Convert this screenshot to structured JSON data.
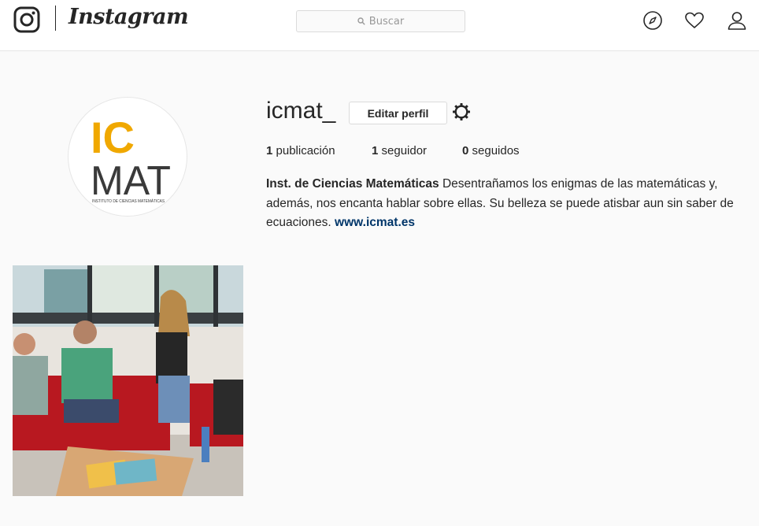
{
  "header": {
    "wordmark": "Instagram",
    "search": {
      "placeholder": "Buscar"
    }
  },
  "profile": {
    "username": "icmat_",
    "edit_label": "Editar perfil",
    "avatar_logo": {
      "line1": "IC",
      "line2": "MAT",
      "tagline": "INSTITUTO DE CIENCIAS MATEMÁTICAS"
    },
    "stats": {
      "posts_count": "1",
      "posts_label": "publicación",
      "followers_count": "1",
      "followers_label": "seguidor",
      "following_count": "0",
      "following_label": "seguidos"
    },
    "bio": {
      "name": "Inst. de Ciencias Matemáticas",
      "text": "Desentrañamos los enigmas de las matemáticas y, además, nos encanta hablar sobre ellas. Su belleza se puede atisbar aun sin saber de ecuaciones.",
      "link": "www.icmat.es"
    }
  },
  "colors": {
    "accent_yellow": "#f0a800",
    "link": "#003569",
    "couch_red": "#b81820"
  },
  "icons": [
    "instagram-logo-icon",
    "search-icon",
    "explore-compass-icon",
    "heart-icon",
    "user-icon",
    "gear-icon"
  ]
}
